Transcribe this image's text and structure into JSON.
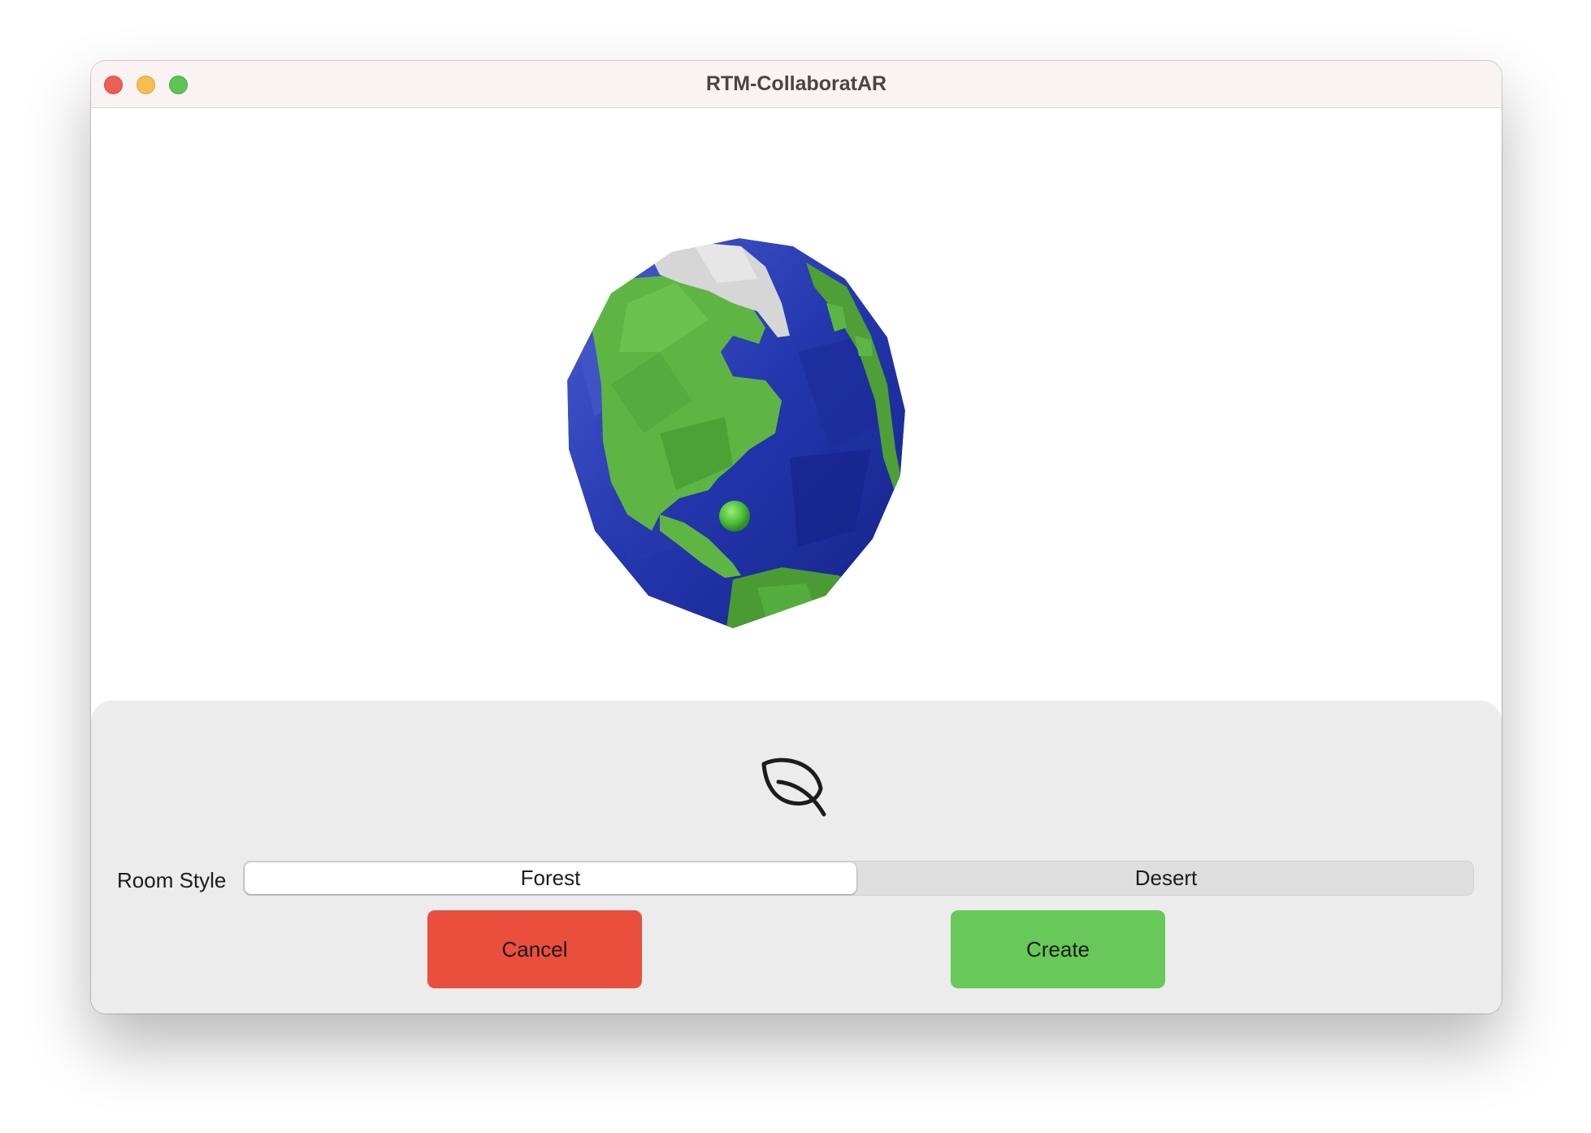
{
  "window": {
    "title": "RTM-CollaboratAR"
  },
  "scene": {
    "object": "globe",
    "icon": "leaf-icon"
  },
  "form": {
    "room_style_label": "Room Style",
    "room_style_options": [
      "Forest",
      "Desert"
    ],
    "room_style_selected": "Forest",
    "cancel_label": "Cancel",
    "create_label": "Create"
  },
  "colors": {
    "cancel": "#ea4e3d",
    "create": "#67c957",
    "ocean": "#2236a8",
    "land": "#5fb544",
    "ice": "#d6d6d6"
  }
}
